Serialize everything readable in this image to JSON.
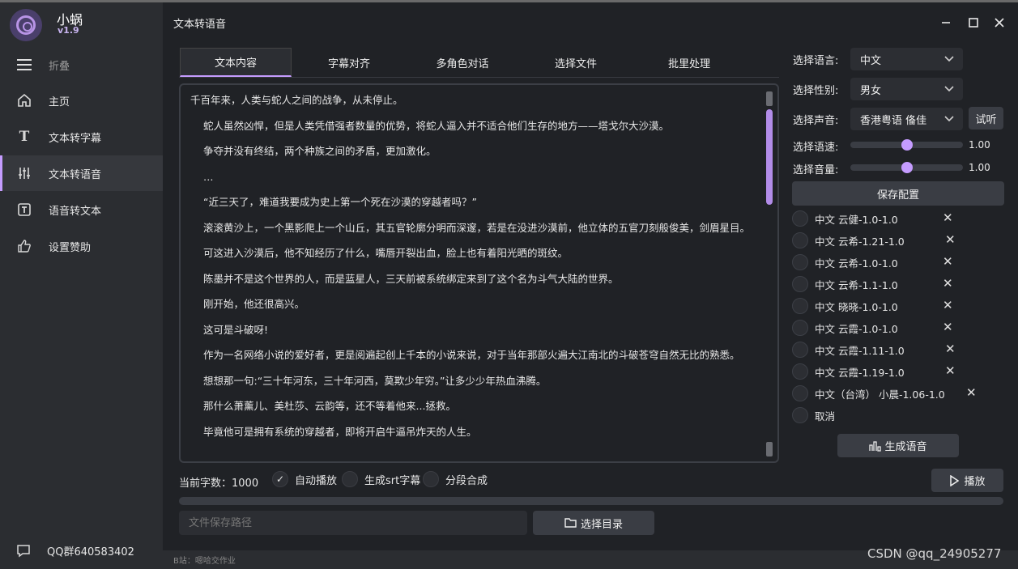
{
  "app": {
    "name": "小蜗",
    "version": "v1.9",
    "window_title": "文本转语音"
  },
  "sidebar": {
    "collapse_label": "折叠",
    "items": [
      {
        "label": "主页",
        "icon": "home-icon"
      },
      {
        "label": "文本转字幕",
        "icon": "text-t-icon"
      },
      {
        "label": "文本转语音",
        "icon": "sliders-icon",
        "active": true
      },
      {
        "label": "语音转文本",
        "icon": "text-box-icon"
      },
      {
        "label": "设置赞助",
        "icon": "thumbs-up-icon"
      }
    ],
    "qq_group": "QQ群640583402"
  },
  "tabs": [
    {
      "label": "文本内容",
      "active": true
    },
    {
      "label": "字幕对齐"
    },
    {
      "label": "多角色对话"
    },
    {
      "label": "选择文件"
    },
    {
      "label": "批里处理"
    }
  ],
  "editor": {
    "paragraphs": [
      "千百年来，人类与蛇人之间的战争，从未停止。",
      "蛇人虽然凶悍，但是人类凭借强者数量的优势，将蛇人逼入并不适合他们生存的地方——塔戈尔大沙漠。",
      "争夺并没有终结，两个种族之间的矛盾，更加激化。",
      "…",
      "“近三天了，难道我要成为史上第一个死在沙漠的穿越者吗？”",
      "滚滚黄沙上，一个黑影爬上一个山丘，其五官轮廓分明而深邃，若是在没进沙漠前，他立体的五官刀刻般俊美，剑眉星目。",
      "可这进入沙漠后，他不知经历了什么，嘴唇开裂出血，脸上也有着阳光晒的斑纹。",
      "陈墨并不是这个世界的人，而是蓝星人，三天前被系统绑定来到了这个名为斗气大陆的世界。",
      "刚开始，他还很高兴。",
      "这可是斗破呀!",
      "作为一名网络小说的爱好者，更是阅遍起创上千本的小说来说，对于当年那部火遍大江南北的斗破苍穹自然无比的熟悉。",
      "想想那一句:“三十年河东，三十年河西，莫欺少年穷。”让多少少年热血沸腾。",
      "那什么萧薰儿、美杜莎、云韵等，还不等着他来...拯救。",
      "毕竟他可是拥有系统的穿越者，即将开启牛逼吊炸天的人生。"
    ]
  },
  "controls": {
    "count_label": "当前字数：1000",
    "auto_play": {
      "label": "自动播放",
      "checked": true
    },
    "gen_srt": {
      "label": "生成srt字幕",
      "checked": false
    },
    "segment": {
      "label": "分段合成",
      "checked": false
    },
    "play_label": "播放",
    "path_placeholder": "文件保存路径",
    "choose_dir_label": "选择目录"
  },
  "settings": {
    "language_label": "选择语言:",
    "language_value": "中文",
    "gender_label": "选择性别:",
    "gender_value": "男女",
    "voice_label": "选择声音:",
    "voice_value": "香港粤语 俻佳",
    "listen_label": "试听",
    "speed_label": "选择语速:",
    "speed_value": "1.00",
    "speed_fraction": 0.5,
    "volume_label": "选择音量:",
    "volume_value": "1.00",
    "volume_fraction": 0.5,
    "save_label": "保存配置"
  },
  "voice_presets": [
    "中文 云健-1.0-1.0",
    "中文 云希-1.21-1.0",
    "中文 云希-1.0-1.0",
    "中文 云希-1.1-1.0",
    "中文 晓晓-1.0-1.0",
    "中文 云霞-1.0-1.0",
    "中文 云霞-1.11-1.0",
    "中文 云霞-1.19-1.0",
    "中文（台湾） 小晨-1.06-1.0"
  ],
  "cancel_label": "取消",
  "generate_label": "生成语音",
  "footer": {
    "b_site": "B站：嗯哈交作业",
    "watermark": "CSDN @qq_24905277"
  },
  "colors": {
    "accent": "#c59cff",
    "background": "#202226",
    "sidebar": "#2b2d31",
    "button": "#3a3d44"
  }
}
